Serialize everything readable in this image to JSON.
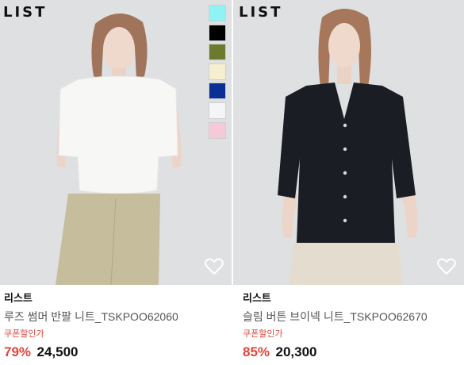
{
  "products": [
    {
      "brand_logo": "LIST",
      "brand": "리스트",
      "title": "루즈 썸머 반팔 니트_TSKPOO62060",
      "coupon": "쿠폰할인가",
      "discount": "79%",
      "price": "24,500",
      "swatches": [
        "#8ff3f4",
        "#000000",
        "#6c7a2e",
        "#f6efce",
        "#0a2f94",
        "#f4f5f7",
        "#f6c9d9"
      ]
    },
    {
      "brand_logo": "LIST",
      "brand": "리스트",
      "title": "슬림 버튼 브이넥 니트_TSKPOO62670",
      "coupon": "쿠폰할인가",
      "discount": "85%",
      "price": "20,300"
    }
  ],
  "colors": {
    "accent_red": "#e0453a",
    "photo_bg": "#dfe0e2"
  },
  "icons": [
    "heart-icon"
  ]
}
